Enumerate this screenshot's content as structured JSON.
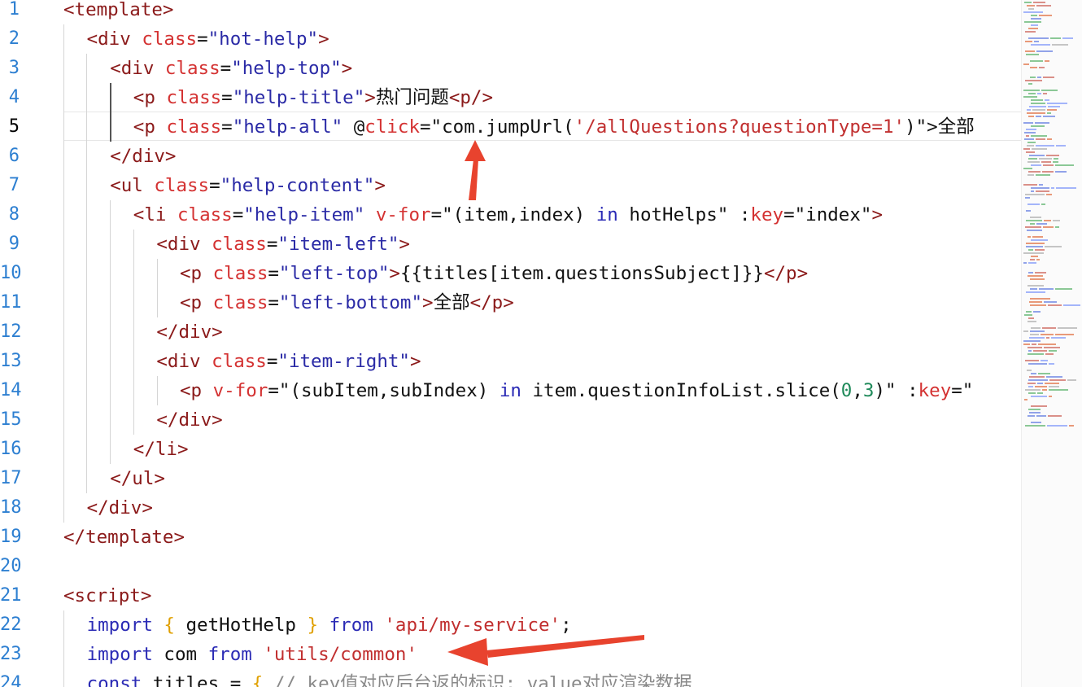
{
  "editor": {
    "current_line": 5,
    "lines": [
      {
        "n": "1",
        "indent": 0,
        "tokens": [
          [
            "tag",
            "<template>"
          ]
        ]
      },
      {
        "n": "2",
        "indent": 1,
        "tokens": [
          [
            "tag",
            "<div "
          ],
          [
            "attr",
            "class"
          ],
          [
            "txt",
            "="
          ],
          [
            "str",
            "\"hot-help\""
          ],
          [
            "tag",
            ">"
          ]
        ]
      },
      {
        "n": "3",
        "indent": 2,
        "tokens": [
          [
            "tag",
            "<div "
          ],
          [
            "attr",
            "class"
          ],
          [
            "txt",
            "="
          ],
          [
            "str",
            "\"help-top\""
          ],
          [
            "tag",
            ">"
          ]
        ]
      },
      {
        "n": "4",
        "indent": 3,
        "tokens": [
          [
            "tag",
            "<p "
          ],
          [
            "attr",
            "class"
          ],
          [
            "txt",
            "="
          ],
          [
            "str",
            "\"help-title\""
          ],
          [
            "tag",
            ">"
          ],
          [
            "txt",
            "热门问题"
          ],
          [
            "tag",
            "<p/>"
          ]
        ]
      },
      {
        "n": "5",
        "indent": 3,
        "tokens": [
          [
            "tag",
            "<p "
          ],
          [
            "attr",
            "class"
          ],
          [
            "txt",
            "="
          ],
          [
            "str",
            "\"help-all\""
          ],
          [
            "txt",
            " @"
          ],
          [
            "attr",
            "click"
          ],
          [
            "txt",
            "=\"com.jumpUrl("
          ],
          [
            "sq",
            "'/allQuestions?questionType=1'"
          ],
          [
            "txt",
            ")\">全部"
          ]
        ]
      },
      {
        "n": "6",
        "indent": 2,
        "tokens": [
          [
            "tag",
            "</div>"
          ]
        ]
      },
      {
        "n": "7",
        "indent": 2,
        "tokens": [
          [
            "tag",
            "<ul "
          ],
          [
            "attr",
            "class"
          ],
          [
            "txt",
            "="
          ],
          [
            "str",
            "\"help-content\""
          ],
          [
            "tag",
            ">"
          ]
        ]
      },
      {
        "n": "8",
        "indent": 3,
        "tokens": [
          [
            "tag",
            "<li "
          ],
          [
            "attr",
            "class"
          ],
          [
            "txt",
            "="
          ],
          [
            "str",
            "\"help-item\""
          ],
          [
            "txt",
            " "
          ],
          [
            "attr",
            "v-for"
          ],
          [
            "txt",
            "=\"(item,index) "
          ],
          [
            "kw",
            "in"
          ],
          [
            "txt",
            " hotHelps\" :"
          ],
          [
            "attr",
            "key"
          ],
          [
            "txt",
            "=\"index\""
          ],
          [
            "tag",
            ">"
          ]
        ]
      },
      {
        "n": "9",
        "indent": 4,
        "tokens": [
          [
            "tag",
            "<div "
          ],
          [
            "attr",
            "class"
          ],
          [
            "txt",
            "="
          ],
          [
            "str",
            "\"item-left\""
          ],
          [
            "tag",
            ">"
          ]
        ]
      },
      {
        "n": "10",
        "indent": 5,
        "tokens": [
          [
            "tag",
            "<p "
          ],
          [
            "attr",
            "class"
          ],
          [
            "txt",
            "="
          ],
          [
            "str",
            "\"left-top\""
          ],
          [
            "tag",
            ">"
          ],
          [
            "txt",
            "{{titles[item.questionsSubject]}}"
          ],
          [
            "tag",
            "</p>"
          ]
        ]
      },
      {
        "n": "11",
        "indent": 5,
        "tokens": [
          [
            "tag",
            "<p "
          ],
          [
            "attr",
            "class"
          ],
          [
            "txt",
            "="
          ],
          [
            "str",
            "\"left-bottom\""
          ],
          [
            "tag",
            ">"
          ],
          [
            "txt",
            "全部"
          ],
          [
            "tag",
            "</p>"
          ]
        ]
      },
      {
        "n": "12",
        "indent": 4,
        "tokens": [
          [
            "tag",
            "</div>"
          ]
        ]
      },
      {
        "n": "13",
        "indent": 4,
        "tokens": [
          [
            "tag",
            "<div "
          ],
          [
            "attr",
            "class"
          ],
          [
            "txt",
            "="
          ],
          [
            "str",
            "\"item-right\""
          ],
          [
            "tag",
            ">"
          ]
        ]
      },
      {
        "n": "14",
        "indent": 5,
        "tokens": [
          [
            "tag",
            "<p "
          ],
          [
            "attr",
            "v-for"
          ],
          [
            "txt",
            "=\"(subItem,subIndex) "
          ],
          [
            "kw",
            "in"
          ],
          [
            "txt",
            " item.questionInfoList.slice("
          ],
          [
            "num",
            "0"
          ],
          [
            "txt",
            ","
          ],
          [
            "num",
            "3"
          ],
          [
            "txt",
            ")\" :"
          ],
          [
            "attr",
            "key"
          ],
          [
            "txt",
            "=\""
          ]
        ]
      },
      {
        "n": "15",
        "indent": 4,
        "tokens": [
          [
            "tag",
            "</div>"
          ]
        ]
      },
      {
        "n": "16",
        "indent": 3,
        "tokens": [
          [
            "tag",
            "</li>"
          ]
        ]
      },
      {
        "n": "17",
        "indent": 2,
        "tokens": [
          [
            "tag",
            "</ul>"
          ]
        ]
      },
      {
        "n": "18",
        "indent": 1,
        "tokens": [
          [
            "tag",
            "</div>"
          ]
        ]
      },
      {
        "n": "19",
        "indent": 0,
        "tokens": [
          [
            "tag",
            "</template>"
          ]
        ]
      },
      {
        "n": "20",
        "indent": 0,
        "tokens": []
      },
      {
        "n": "21",
        "indent": 0,
        "tokens": [
          [
            "tag",
            "<script>"
          ]
        ]
      },
      {
        "n": "22",
        "indent": 1,
        "tokens": [
          [
            "kw",
            "import"
          ],
          [
            "txt",
            " "
          ],
          [
            "brace",
            "{"
          ],
          [
            "txt",
            " getHotHelp "
          ],
          [
            "brace",
            "}"
          ],
          [
            "txt",
            " "
          ],
          [
            "kw",
            "from"
          ],
          [
            "txt",
            " "
          ],
          [
            "sq",
            "'api/my-service'"
          ],
          [
            "txt",
            ";"
          ]
        ]
      },
      {
        "n": "23",
        "indent": 1,
        "tokens": [
          [
            "kw",
            "import"
          ],
          [
            "txt",
            " com "
          ],
          [
            "kw",
            "from"
          ],
          [
            "txt",
            " "
          ],
          [
            "sq",
            "'utils/common'"
          ]
        ]
      },
      {
        "n": "24",
        "indent": 1,
        "tokens": [
          [
            "kw",
            "const"
          ],
          [
            "txt",
            " titles = "
          ],
          [
            "brace",
            "{"
          ],
          [
            "txt",
            " "
          ],
          [
            "cm",
            "// key值对应后台返的标识; value对应渲染数据"
          ]
        ]
      }
    ]
  },
  "minimap": {
    "label": "minimap"
  }
}
